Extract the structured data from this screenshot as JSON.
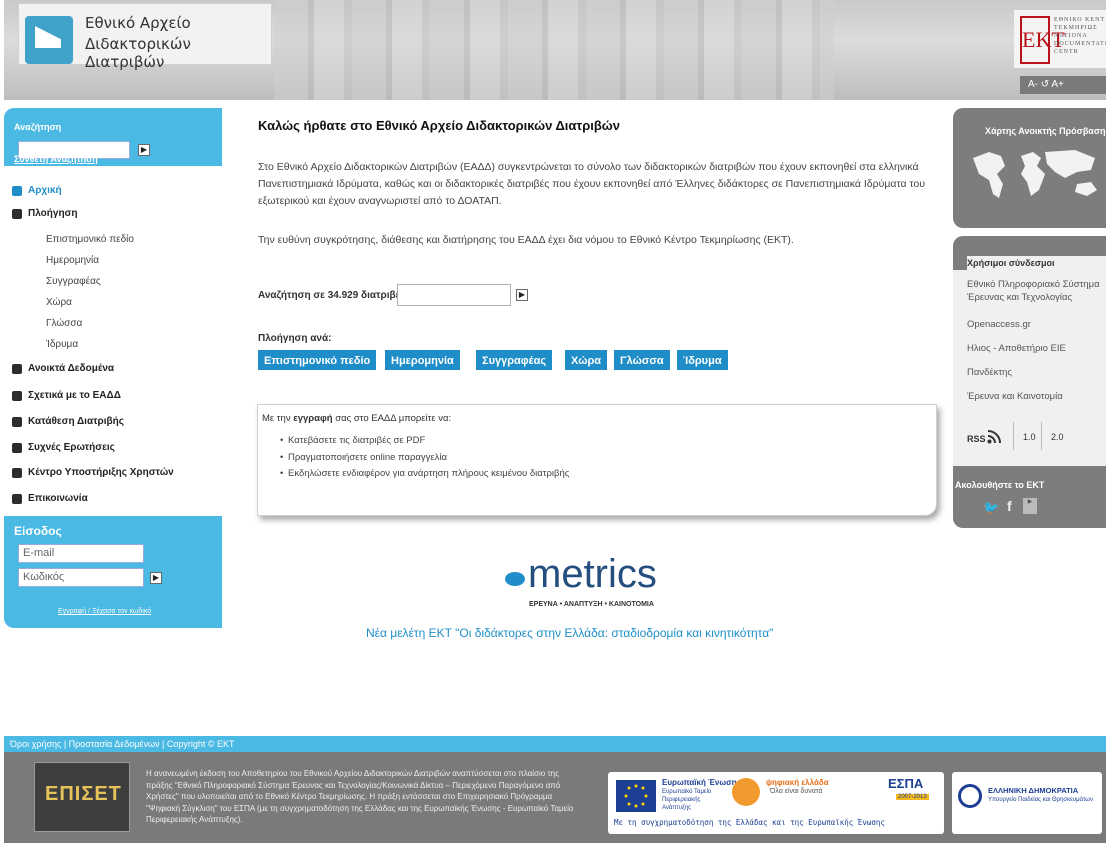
{
  "header": {
    "logo_line1": "Εθνικό Αρχείο",
    "logo_line2": "Διδακτορικών Διατριβών",
    "ekt_mark": "EKT",
    "ekt_text": [
      "ΕΘΝΙΚΟ ΚΕΝΤ",
      "ΤΕΚΜΗΡΙΩΣ",
      "NATIONA",
      "DOCUMENTATI",
      "CENTR"
    ],
    "font_size_controls": "A- ↺ A+"
  },
  "sidebar": {
    "search_label": "Αναζήτηση",
    "search_value": "",
    "advanced_search": "Σύνθετη Αναζήτηση",
    "go_symbol": "▶",
    "nav": [
      {
        "label": "Αρχική"
      },
      {
        "label": "Πλοήγηση"
      },
      {
        "label": "Ανοικτά Δεδομένα"
      },
      {
        "label": "Σχετικά με το ΕΑΔΔ"
      },
      {
        "label": "Κατάθεση Διατριβής"
      },
      {
        "label": "Συχνές Ερωτήσεις"
      },
      {
        "label": "Κέντρο Υποστήριξης Χρηστών"
      },
      {
        "label": "Επικοινωνία"
      }
    ],
    "browse_sub": [
      "Επιστημονικό πεδίο",
      "Ημερομηνία",
      "Συγγραφέας",
      "Χώρα",
      "Γλώσσα",
      "Ίδρυμα"
    ],
    "login": {
      "title": "Είσοδος",
      "email_placeholder": "E-mail",
      "password_placeholder": "Κωδικός",
      "links": "Εγγραφή / Ξέχασα τον κωδικό"
    }
  },
  "main": {
    "title": "Καλώς ήρθατε στο Εθνικό Αρχείο Διδακτορικών Διατριβών",
    "para1": "Στο Εθνικό Αρχείο Διδακτορικών Διατριβών (ΕΑΔΔ) συγκεντρώνεται το σύνολο των διδακτορικών διατριβών που έχουν εκπονηθεί στα ελληνικά Πανεπιστημιακά Ιδρύματα, καθώς και οι διδακτορικές διατριβές που έχουν εκπονηθεί από Έλληνες διδάκτορες σε Πανεπιστημιακά Ιδρύματα του εξωτερικού και έχουν αναγνωριστεί από το ΔΟΑΤΑΠ.",
    "para2": "Την ευθύνη συγκρότησης, διάθεσης και διατήρησης του ΕΑΔΔ έχει δια νόμου το Εθνικό Κέντρο Τεκμηρίωσης (ΕΚΤ).",
    "search_label": "Αναζήτηση σε 34.929 διατριβές",
    "search_value": "",
    "browse_label": "Πλοήγηση ανά:",
    "browse_buttons": [
      "Επιστημονικό πεδίο",
      "Ημερομηνία",
      "Συγγραφέας",
      "Χώρα",
      "Γλώσσα",
      "Ίδρυμα"
    ],
    "register_intro_pre": "Με την ",
    "register_intro_bold": "εγγραφή",
    "register_intro_post": " σας στο ΕΑΔΔ μπορείτε να:",
    "register_items": [
      "Κατεβάσετε τις διατριβές σε PDF",
      "Πραγματοποιήσετε online παραγγελία",
      "Εκδηλώσετε ενδιαφέρον για ανάρτηση πλήρους κειμένου διατριβής"
    ],
    "metrics_word": "metrics",
    "metrics_sub": "ΕΡΕΥΝΑ • ΑΝΑΠΤΥΞΗ • ΚΑΙΝΟΤΟΜΙΑ",
    "study_link": "Νέα μελέτη ΕΚΤ \"Οι διδάκτορες στην Ελλάδα: σταδιοδρομία και κινητικότητα\""
  },
  "right": {
    "map_title": "Χάρτης Ανοικτής Πρόσβασης",
    "links_title": "Χρήσιμοι σύνδεσμοι",
    "links": [
      "Εθνικό Πληροφοριακό Σύστημα Έρευνας και Τεχνολογίας",
      "Openaccess.gr",
      "Ηλιος - Αποθετήριο ΕΙΕ",
      "Πανδέκτης",
      "Έρευνα και Καινοτομία"
    ],
    "rss": "RSS",
    "rss_v1": "1.0",
    "rss_v2": "2.0",
    "follow": "Ακολουθήστε το ΕΚΤ"
  },
  "footer": {
    "links": "Όροι χρήσης | Προστασία Δεδομένων | Copyright © ΕΚΤ",
    "epset": "ΕΠΙΣΕΤ",
    "text": "Η ανανεωμένη έκδοση του Αποθετηρίου του Εθνικού Αρχείου Διδακτορικών Διατριβών αναπτύσσεται στο πλαίσιο της πράξης \"Εθνικό Πληροφοριακό Σύστημα Έρευνας και Τεχνολογίας/Κοινωνικά Δίκτυα – Περιεχόμενο Παραγόμενο από Χρήστες\" που υλοποιείται από το Εθνικό Κέντρο Τεκμηρίωσης. Η πράξη εντάσσεται στο Επιχειρησιακό Πρόγραμμα \"Ψηφιακή Σύγκλιση\" του ΕΣΠΑ (με τη συγχρηματοδότηση της Ελλάδας και της Ευρωπαϊκής Ένωσης - Ευρωπαϊκό Ταμείο Περιφερειακής Ανάπτυξης).",
    "eu_title": "Ευρωπαϊκή Ένωση",
    "eu_sub": "Ευρωπαϊκό Ταμείο Περιφερειακής Ανάπτυξης",
    "digital": "ψηφιακή ελλάδα",
    "digital_sub": "Όλα είναι δυνατά",
    "espa": "ΕΣΠΑ",
    "espa_years": "2007-2013",
    "cofund": "Με τη συγχρηματοδότηση της Ελλάδας και της Ευρωπαϊκής Ένωσης",
    "gr_title": "ΕΛΛΗΝΙΚΗ ΔΗΜΟΚΡΑΤΙΑ",
    "gr_sub": "Υπουργείο Παιδείας και Θρησκευμάτων"
  }
}
